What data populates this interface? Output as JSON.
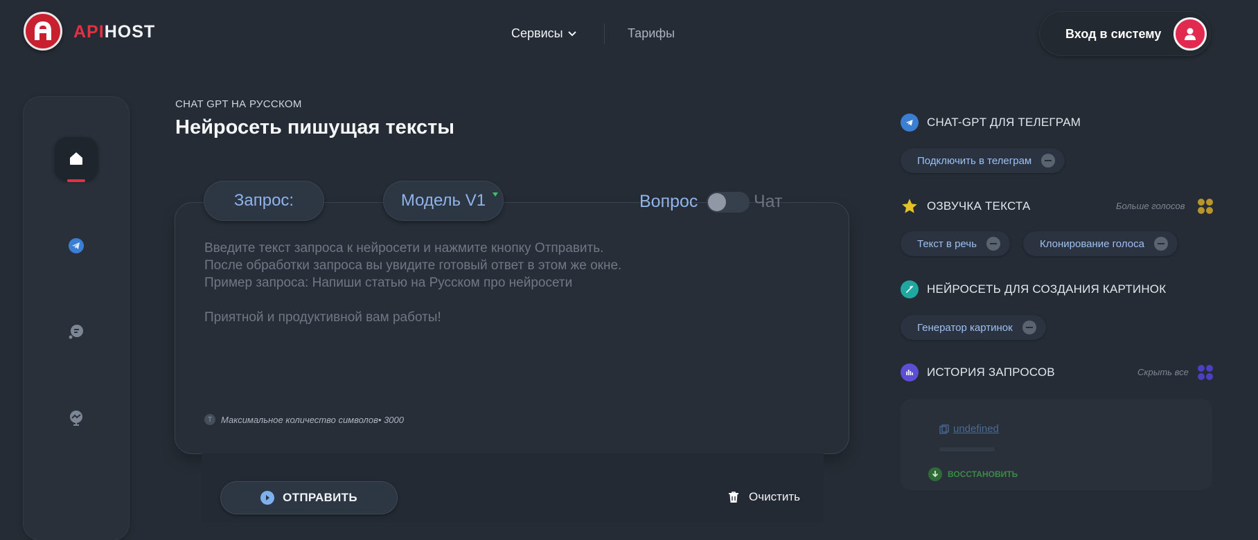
{
  "header": {
    "logo_api": "API",
    "logo_host": "HOST",
    "nav_services": "Сервисы",
    "nav_tariffs": "Тарифы",
    "login_label": "Вход в систему"
  },
  "main": {
    "subtitle": "CHAT GPT НА РУССКОМ",
    "title": "Нейросеть пишущая тексты",
    "query_label": "Запрос:",
    "model_label": "Модель V1",
    "mode_question": "Вопрос",
    "mode_chat": "Чат",
    "placeholder": "Введите текст запроса к нейросети и нажмите кнопку Отправить.\nПосле обработки запроса вы увидите готовый ответ в этом же окне.\nПример запроса: Напиши статью на Русском про нейросети\n\nПриятной и продуктивной вам работы!",
    "max_chars_label": "Максимальное количество символов•",
    "max_chars_value": "3000",
    "send_label": "ОТПРАВИТЬ",
    "clear_label": "Очистить"
  },
  "right": {
    "telegram": {
      "title": "CHAT-GPT ДЛЯ ТЕЛЕГРАМ",
      "chips": [
        "Подключить в телеграм"
      ]
    },
    "voice": {
      "title": "ОЗВУЧКА ТЕКСТА",
      "more": "Больше голосов",
      "chips": [
        "Текст в речь",
        "Клонирование голоса"
      ]
    },
    "images": {
      "title": "НЕЙРОСЕТЬ ДЛЯ СОЗДАНИЯ КАРТИНОК",
      "chips": [
        "Генератор картинок"
      ]
    },
    "history": {
      "title": "ИСТОРИЯ ЗАПРОСОВ",
      "hide_all": "Скрыть все",
      "item": "undefined",
      "restore": "ВОССТАНОВИТЬ"
    }
  },
  "colors": {
    "background": "#262c35",
    "accent_red": "#e33042",
    "accent_blue": "#8fb4ea",
    "avatar_pink": "#e2294f"
  }
}
